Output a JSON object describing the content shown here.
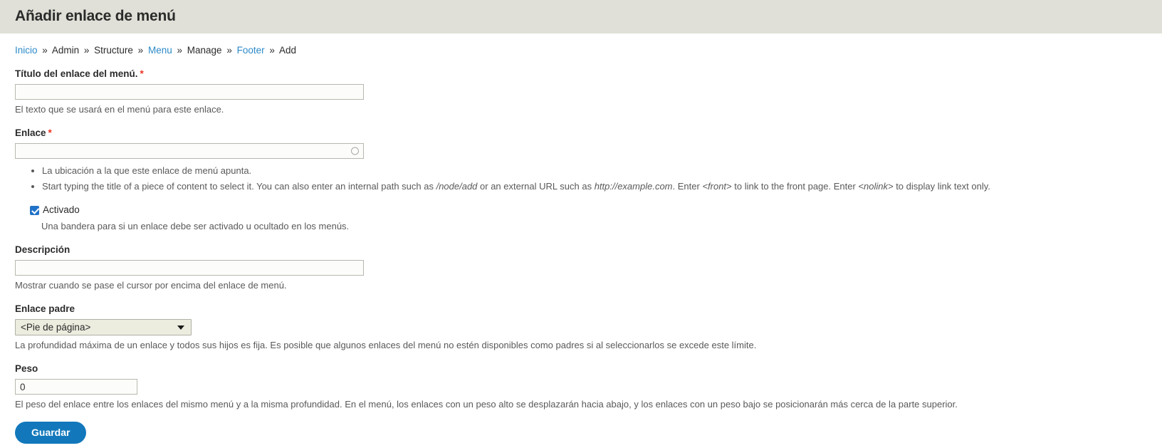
{
  "page": {
    "title": "Añadir enlace de menú"
  },
  "breadcrumb": {
    "separator": "»",
    "items": [
      {
        "label": "Inicio",
        "link": true
      },
      {
        "label": "Admin",
        "link": false
      },
      {
        "label": "Structure",
        "link": false
      },
      {
        "label": "Menu",
        "link": true
      },
      {
        "label": "Manage",
        "link": false
      },
      {
        "label": "Footer",
        "link": true
      },
      {
        "label": "Add",
        "link": false
      }
    ]
  },
  "form": {
    "title_field": {
      "label": "Título del enlace del menú.",
      "required_mark": "*",
      "value": "",
      "description": "El texto que se usará en el menú para este enlace."
    },
    "link_field": {
      "label": "Enlace",
      "required_mark": "*",
      "value": "",
      "throbber_icon": "circle-throbber-icon",
      "descriptions": [
        "La ubicación a la que este enlace de menú apunta.",
        "Start typing the title of a piece of content to select it. You can also enter an internal path such as /node/add or an external URL such as http://example.com. Enter <front> to link to the front page. Enter <nolink> to display link text only."
      ],
      "description2_parts": {
        "p1": "Start typing the title of a piece of content to select it. You can also enter an internal path such as ",
        "em1": "/node/add",
        "p2": " or an external URL such as ",
        "em2": "http://example.com",
        "p3": ". Enter ",
        "em3": "<front>",
        "p4": " to link to the front page. Enter ",
        "em4": "<nolink>",
        "p5": " to display link text only."
      }
    },
    "enabled_field": {
      "label": "Activado",
      "checked": true,
      "description": "Una bandera para si un enlace debe ser activado u ocultado en los menús."
    },
    "description_field": {
      "label": "Descripción",
      "value": "",
      "description": "Mostrar cuando se pase el cursor por encima del enlace de menú."
    },
    "parent_field": {
      "label": "Enlace padre",
      "selected": "<Pie de página>",
      "options": [
        "<Pie de página>"
      ],
      "arrow_icon": "chevron-down-icon",
      "description": "La profundidad máxima de un enlace y todos sus hijos es fija. Es posible que algunos enlaces del menú no estén disponibles como padres si al seleccionarlos se excede este límite."
    },
    "weight_field": {
      "label": "Peso",
      "value": "0",
      "description": "El peso del enlace entre los enlaces del mismo menú y a la misma profundidad. En el menú, los enlaces con un peso alto se desplazarán hacia abajo, y los enlaces con un peso bajo se posicionarán más cerca de la parte superior."
    },
    "submit": {
      "label": "Guardar"
    }
  }
}
